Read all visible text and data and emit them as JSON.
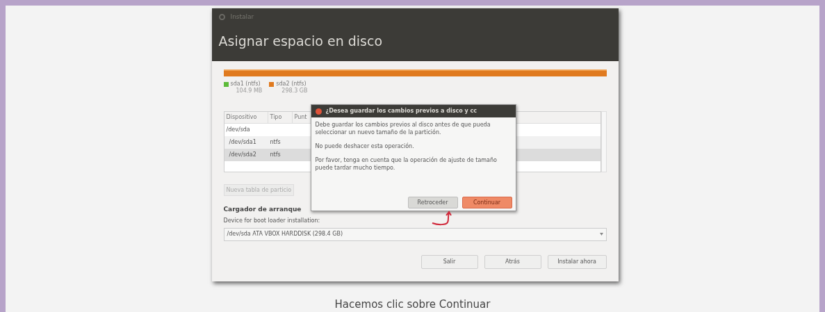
{
  "window": {
    "title": "Instalar",
    "heading": "Asignar espacio en disco"
  },
  "partitions": [
    {
      "name": "sda1 (ntfs)",
      "size": "104.9 MB",
      "color": "#5dbb3a"
    },
    {
      "name": "sda2 (ntfs)",
      "size": "298.3 GB",
      "color": "#e07a1f"
    }
  ],
  "table": {
    "columns": [
      "Dispositivo",
      "Tipo",
      "Punt"
    ],
    "rows": [
      {
        "cells": [
          "/dev/sda",
          ""
        ],
        "selected": false,
        "child": false
      },
      {
        "cells": [
          "/dev/sda1",
          "ntfs"
        ],
        "selected": false,
        "child": true
      },
      {
        "cells": [
          "/dev/sda2",
          "ntfs"
        ],
        "selected": true,
        "child": true
      }
    ]
  },
  "new_table_button": "Nueva tabla de particio",
  "bootloader": {
    "heading": "Cargador de arranque",
    "label": "Device for boot loader installation:",
    "value": "/dev/sda ATA VBOX HARDDISK (298.4 GB)"
  },
  "buttons": [
    {
      "label": "Salir"
    },
    {
      "label": "Atrás"
    },
    {
      "label": "Instalar ahora"
    }
  ],
  "dialog": {
    "title": "¿Desea guardar los cambios previos a disco y cc",
    "paragraphs": [
      "Debe guardar los cambios previos al disco antes de que pueda seleccionar un nuevo tamaño de la partición.",
      "No puede deshacer esta operación.",
      "Por favor, tenga en cuenta que la operación de ajuste de tamaño puede tardar mucho tiempo."
    ],
    "buttons": [
      {
        "label": "Retroceder",
        "kind": "secondary"
      },
      {
        "label": "Continuar",
        "kind": "primary"
      }
    ]
  },
  "caption": "Hacemos clic sobre Continuar"
}
